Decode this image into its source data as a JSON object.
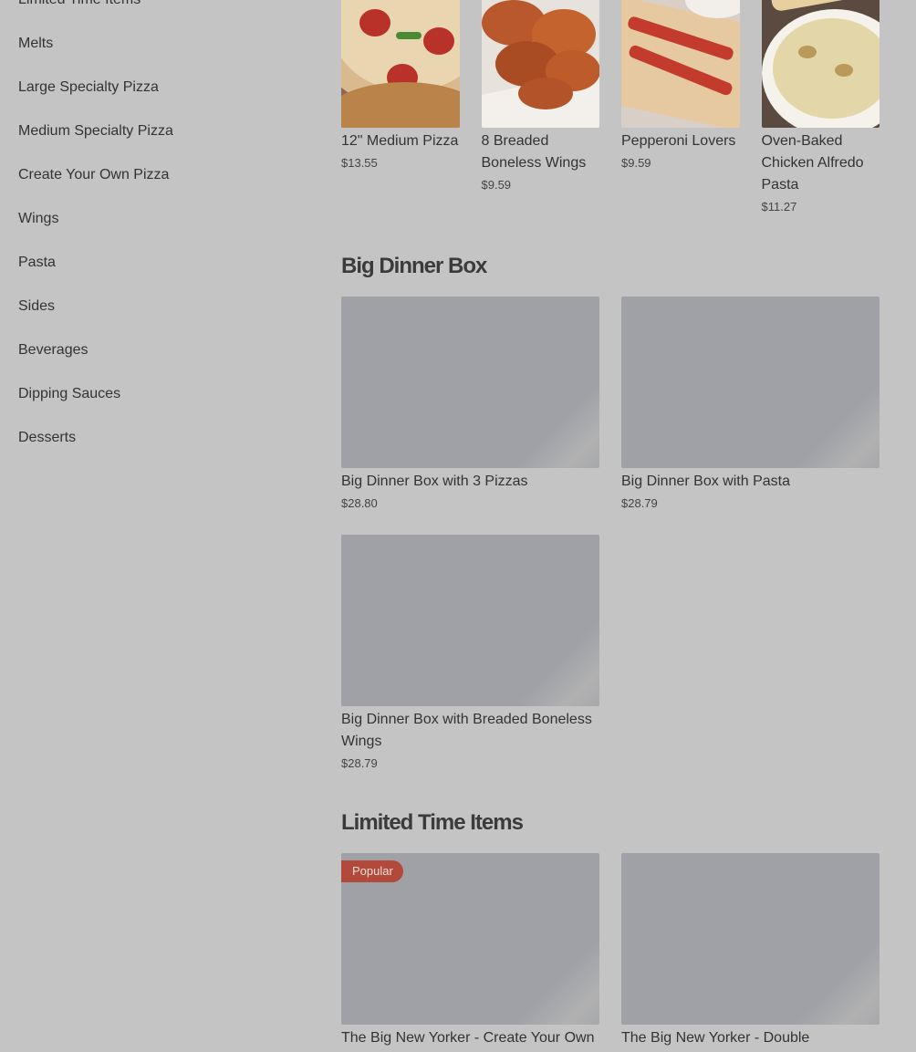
{
  "sidebar": {
    "items": [
      {
        "label": "Limited Time Items"
      },
      {
        "label": "Melts"
      },
      {
        "label": "Large Specialty Pizza"
      },
      {
        "label": "Medium Specialty Pizza"
      },
      {
        "label": "Create Your Own Pizza"
      },
      {
        "label": "Wings"
      },
      {
        "label": "Pasta"
      },
      {
        "label": "Sides"
      },
      {
        "label": "Beverages"
      },
      {
        "label": "Dipping Sauces"
      },
      {
        "label": "Desserts"
      }
    ]
  },
  "top_row": {
    "items": [
      {
        "name": "12\" Medium Pizza",
        "price": "$13.55"
      },
      {
        "name": "8 Breaded Boneless Wings",
        "price": "$9.59"
      },
      {
        "name": "Pepperoni Lovers",
        "price": "$9.59"
      },
      {
        "name": "Oven-Baked Chicken Alfredo Pasta",
        "price": "$11.27"
      }
    ]
  },
  "big_dinner_box": {
    "title": "Big Dinner Box",
    "items": [
      {
        "name": "Big Dinner Box with 3 Pizzas",
        "price": "$28.80"
      },
      {
        "name": "Big Dinner Box with Pasta",
        "price": "$28.79"
      },
      {
        "name": "Big Dinner Box with Breaded Boneless Wings",
        "price": "$28.79"
      }
    ]
  },
  "limited_time": {
    "title": "Limited Time Items",
    "items": [
      {
        "name": "The Big New Yorker - Create Your Own",
        "badge": "Popular"
      },
      {
        "name": "The Big New Yorker - Double"
      }
    ]
  },
  "colors": {
    "overlay_bg": "#c4c4c4",
    "placeholder": "#9fa1a6",
    "badge": "#b14a3b"
  }
}
